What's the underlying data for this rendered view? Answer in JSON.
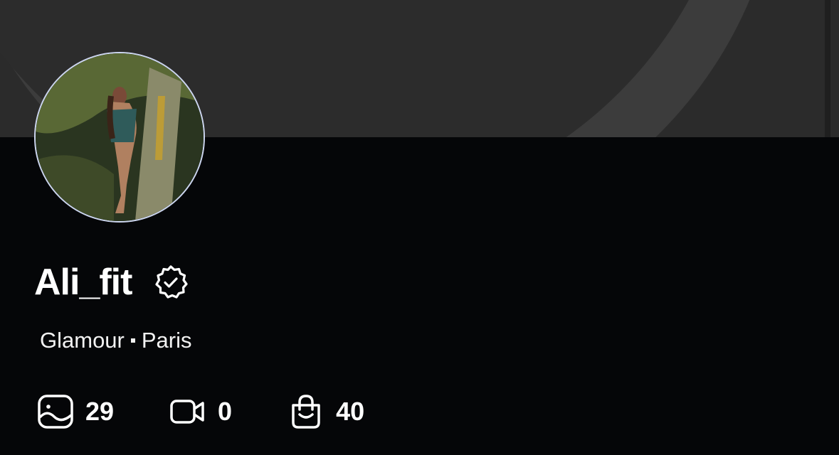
{
  "profile": {
    "name": "Ali_fit",
    "category": "Glamour",
    "location": "Paris"
  },
  "stats": {
    "photos": "29",
    "videos": "0",
    "products": "40"
  },
  "icons": {
    "verified": "verified-badge-icon",
    "photos": "photo-icon",
    "videos": "video-camera-icon",
    "products": "shopping-bag-icon"
  },
  "colors": {
    "background": "#050608",
    "banner": "#2b2b2b",
    "avatar_border": "#cdd6f0",
    "text": "#ffffff"
  }
}
